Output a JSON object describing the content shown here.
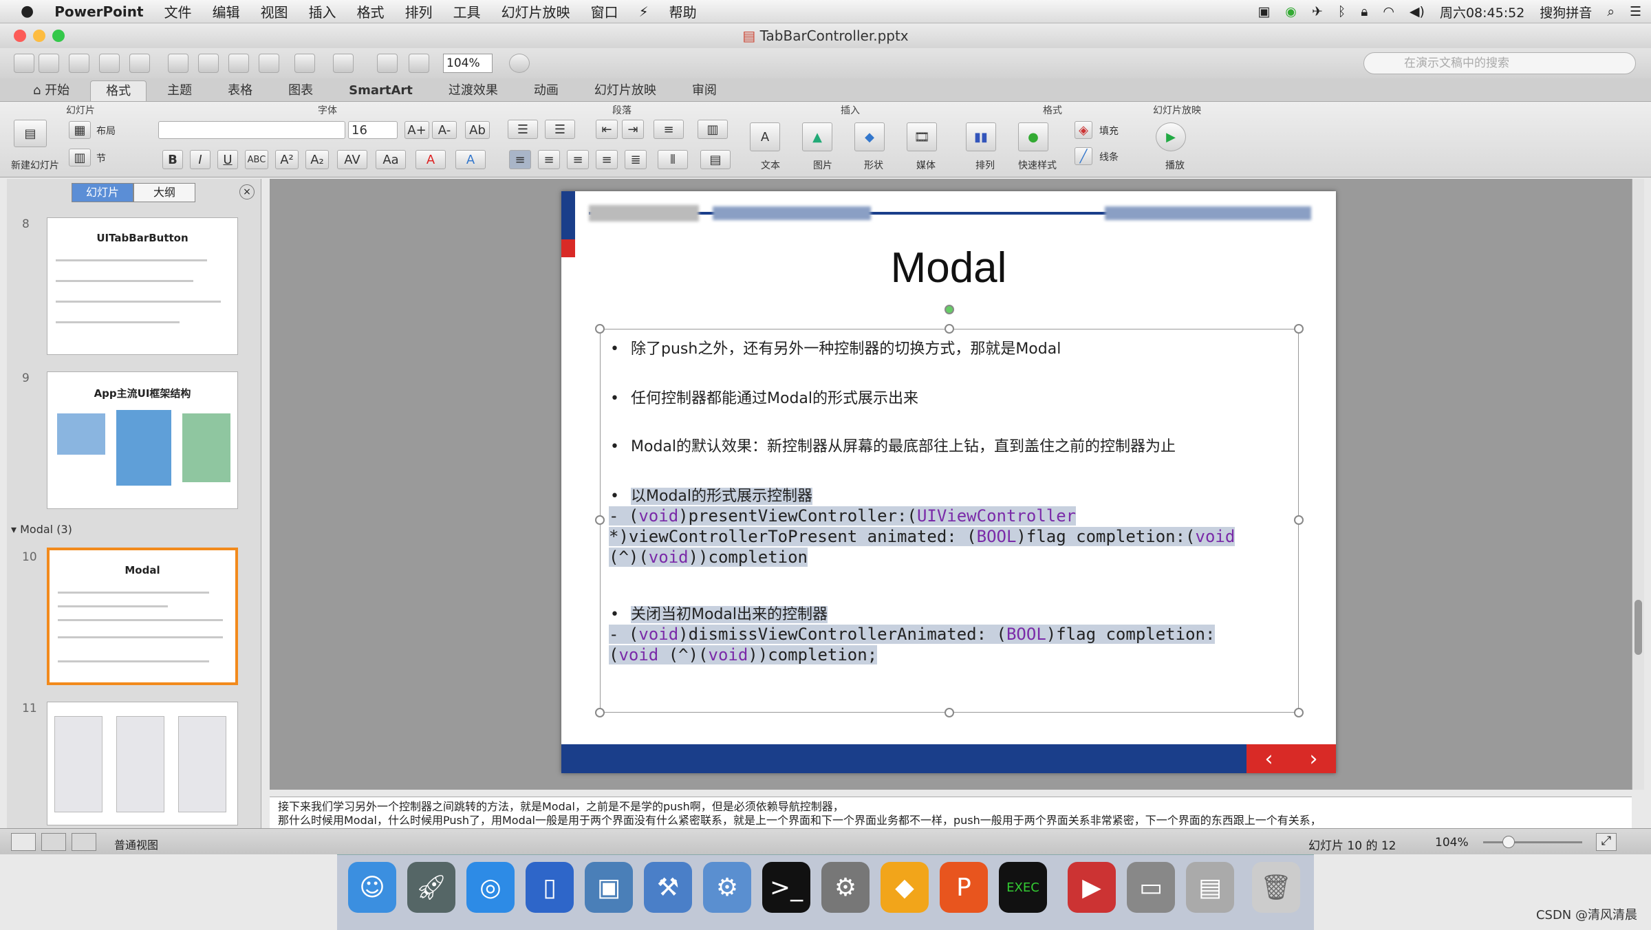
{
  "menubar": {
    "apple": "",
    "items": [
      "PowerPoint",
      "文件",
      "编辑",
      "视图",
      "插入",
      "格式",
      "排列",
      "工具",
      "幻灯片放映",
      "窗口",
      "⚡",
      "帮助"
    ],
    "clock": "周六08:45:52",
    "ime": "搜狗拼音"
  },
  "window": {
    "title": "TabBarController.pptx",
    "zoom": "104%",
    "search_placeholder": "在演示文稿中的搜索"
  },
  "ribbon": {
    "tabs": [
      "开始",
      "格式",
      "主题",
      "表格",
      "图表",
      "SmartArt",
      "过渡效果",
      "动画",
      "幻灯片放映",
      "审阅"
    ],
    "active_tab": 1,
    "groups": {
      "slides": "幻灯片",
      "font": "字体",
      "paragraph": "段落",
      "insert": "插入",
      "format": "格式",
      "slideshow": "幻灯片放映"
    },
    "new_slide": "新建幻灯片",
    "layout": "布局",
    "section": "节",
    "font_name": "",
    "font_size": "16",
    "insert_labels": [
      "文本",
      "图片",
      "形状",
      "媒体"
    ],
    "arrange": "排列",
    "quick_styles": "快速样式",
    "fill": "填充",
    "line": "线条",
    "play": "播放"
  },
  "panel": {
    "view_tabs": [
      "幻灯片",
      "大纲"
    ],
    "active_view": 0,
    "section_title": "Modal (3)",
    "thumbs": [
      {
        "num": "8",
        "title": "UITabBarButton"
      },
      {
        "num": "9",
        "title": "App主流UI框架结构"
      },
      {
        "num": "10",
        "title": "Modal"
      },
      {
        "num": "11",
        "title": ""
      }
    ]
  },
  "slide": {
    "title": "Modal",
    "bullets": [
      "除了push之外，还有另外一种控制器的切换方式，那就是Modal",
      "任何控制器都能通过Modal的形式展示出来",
      "Modal的默认效果：新控制器从屏幕的最底部往上钻，直到盖住之前的控制器为止",
      "以Modal的形式展示控制器",
      "关闭当初Modal出来的控制器"
    ],
    "code1": {
      "l1a": "- (",
      "l1kw": "void",
      "l1b": ")presentViewController:(",
      "l1kw2": "UIViewController",
      "l2a": "*)viewControllerToPresent animated: (",
      "l2kw": "BOOL",
      "l2b": ")flag completion:(",
      "l2kw2": "void",
      "l3a": "(^)(",
      "l3kw": "void",
      "l3b": "))completion"
    },
    "code2": {
      "l1a": "- (",
      "l1kw": "void",
      "l1b": ")dismissViewControllerAnimated: (",
      "l1kw2": "BOOL",
      "l1c": ")flag completion:",
      "l2a": "(",
      "l2kw": "void",
      "l2b": " (^)(",
      "l2kw2": "void",
      "l2c": "))completion;"
    },
    "nav_prev": "‹",
    "nav_next": "›"
  },
  "notes": {
    "line1": "接下来我们学习另外一个控制器之间跳转的方法，就是Modal，之前是不是学的push啊，但是必须依赖导航控制器，",
    "line2": "那什么时候用Modal，什么时候用Push了，用Modal一般是用于两个界面没有什么紧密联系，就是上一个界面和下一个界面业务都不一样，push一般用于两个界面关系非常紧密，下一个界面的东西跟上一个有关系，"
  },
  "status": {
    "view_name": "普通视图",
    "slide_pos": "幻灯片 10 的 12",
    "zoom": "104%"
  },
  "watermark": "CSDN @清风清晨"
}
